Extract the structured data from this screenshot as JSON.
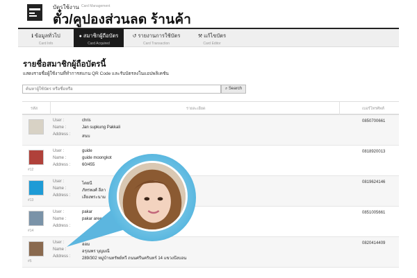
{
  "header": {
    "subtitle_th": "บัตรใช้งาน",
    "subtitle_en": "Card Management",
    "title": "ตั๋ว/คูปองส่วนลด ร้านค้า",
    "logo_icon": "card-icon"
  },
  "nav": {
    "tabs": [
      {
        "label": "ข้อมูลทั่วไป",
        "sub": "Card Info",
        "icon": "info-icon",
        "active": false
      },
      {
        "label": "สมาชิกผู้ถือบัตร",
        "sub": "Card Acquired",
        "icon": "user-icon",
        "active": true
      },
      {
        "label": "รายงานการใช้บัตร",
        "sub": "Card Transaction",
        "icon": "history-icon",
        "active": false
      },
      {
        "label": "แก้ไขบัตร",
        "sub": "Card Editor",
        "icon": "wrench-icon",
        "active": false
      }
    ]
  },
  "main": {
    "title": "รายชื่อสมาชิกผู้ถือบัตรนี้",
    "description": "แสดงรายชื่อผู้ใช้งานที่ทำการสแกน QR Code และรับบัตรลงในแอปพลิเคชัน",
    "search": {
      "placeholder": "ค้นหาผู้ใช้บัตร หรือชื่อหรือ",
      "button": "Search",
      "icon": "search-icon"
    }
  },
  "table": {
    "headers": {
      "num": "รหัส",
      "detail": "รายละเอียด",
      "phone": "เบอร์โทรศัพท์"
    },
    "field_labels": {
      "user": "User :",
      "name": "Name :",
      "address": "Address :"
    },
    "rows": [
      {
        "num": "",
        "user": "chris",
        "name": "Jan supkung Pakkali",
        "address": "สนบ",
        "phone": "0850700661",
        "thumb": "#d8d2c5"
      },
      {
        "num": "#12",
        "user": "guide",
        "name": "guide moongkot",
        "address": "60/455",
        "phone": "0818920013",
        "thumb": "#b0413a"
      },
      {
        "num": "#13",
        "user": "ไตยนี",
        "name": "ภัทรพงศ์ ลีลา",
        "address": "เลียงพระนาม",
        "phone": "0819624146",
        "thumb": "#1e9bd6"
      },
      {
        "num": "#14",
        "user": "pakar",
        "name": "pakar aree",
        "address": "",
        "phone": "0851005661",
        "thumb": "#7a93a8"
      },
      {
        "num": "#5",
        "user": "ออม",
        "name": "อรุณพร บุญมณี",
        "address": "289/302 หมู่บ้านทรัพย์ทวี ถนนศรีนครินทร์ 14 แขวงบึงบอน",
        "phone": "0820414409",
        "thumb": "#8a6a4f"
      }
    ]
  }
}
